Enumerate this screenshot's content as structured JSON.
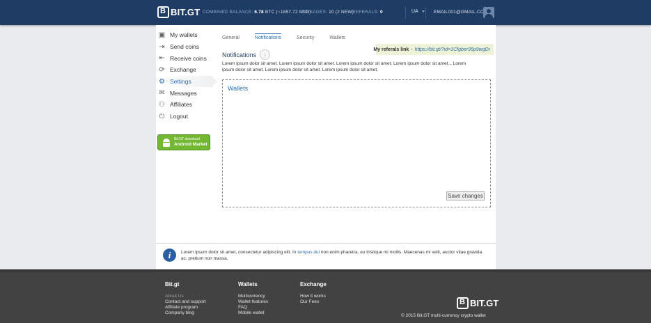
{
  "header": {
    "logo_text": "BIT.GT",
    "balance_label": "COMBINED BALANCE:",
    "balance_value": "6.78",
    "balance_unit": "BTC",
    "balance_usd": "(~1857.72 USD)",
    "messages_label": "MESSAGES:",
    "messages_count": "10",
    "messages_new": "(2 NEW)",
    "referals_label": "REFERALS:",
    "referals_count": "0",
    "language": "UA",
    "email": "EMAIL001@GMAIL.COM"
  },
  "sidebar": {
    "items": [
      {
        "label": "My wallets",
        "icon": "wallet-icon"
      },
      {
        "label": "Send coins",
        "icon": "send-icon"
      },
      {
        "label": "Receive coins",
        "icon": "receive-icon"
      },
      {
        "label": "Exchange",
        "icon": "exchange-icon"
      },
      {
        "label": "Settings",
        "icon": "gear-icon"
      },
      {
        "label": "Messages",
        "icon": "message-icon"
      },
      {
        "label": "Affiliates",
        "icon": "affiliates-icon"
      },
      {
        "label": "Logout",
        "icon": "power-icon"
      }
    ],
    "active_index": 4,
    "android_line1": "Bit.GT download",
    "android_line2": "Android Market"
  },
  "tabs": [
    "General",
    "Notifications",
    "Security",
    "Wallets"
  ],
  "active_tab": 1,
  "referral": {
    "label": "My referals link",
    "dash": "-",
    "url": "https://bit.gt/?id=1Cfgber95p9wgDr"
  },
  "content": {
    "title": "Notifications",
    "description": "Lorem ipsum dolor sit amet. Lorem ipsum dolor sit amet. Lorem ipsum dolor sit amet. Lorem ipsum dolor sit amet... Lorem ipsum dolor sit amet. Lorem ipsum dolor sit amet. Lorem ipsum dolor sit amet.",
    "box_title": "Wallets",
    "save_label": "Save changes"
  },
  "info": {
    "text_before": "Lorem ipsum dolor sit amet, consectetur adipiscing elit. In",
    "link": "tempus dui",
    "text_after": "non enim pharetra, eu tristique mi mollis. Maecenas mi velit, auctor vitae gravida ac, pretium non massa."
  },
  "footer": {
    "col1": {
      "title": "Bit.gt",
      "links": [
        "About Us",
        "Contact and support",
        "Affiliate program",
        "Company blog"
      ]
    },
    "col2": {
      "title": "Wallets",
      "links": [
        "Multicurrency",
        "Wallet features",
        "FAQ",
        "Mobile wallet"
      ]
    },
    "col3": {
      "title": "Exchange",
      "links": [
        "How it works",
        "Our Fees"
      ]
    },
    "logo_text": "BIT.GT",
    "copyright": "© 2015 Bit.GT multi-currency crypto wallet"
  },
  "colors": {
    "header_bg": "#1f3c64",
    "accent": "#2b6ea8",
    "android_green": "#73b833",
    "footer_bg": "#424242"
  }
}
